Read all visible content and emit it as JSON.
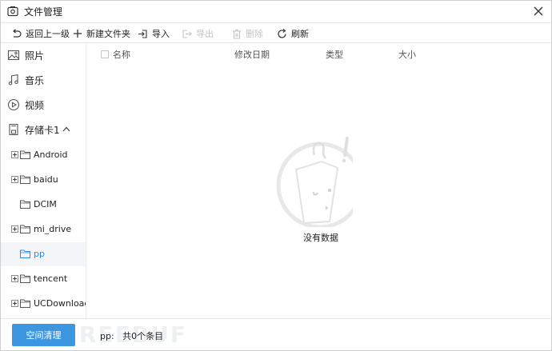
{
  "window": {
    "title": "文件管理",
    "app_icon": "camera-icon",
    "close_icon": "close-icon"
  },
  "toolbar": {
    "back": {
      "label": "返回上一级",
      "icon": "undo-arrow-icon",
      "enabled": true
    },
    "new_folder": {
      "label": "新建文件夹",
      "icon": "plus-icon",
      "enabled": true
    },
    "import": {
      "label": "导入",
      "icon": "import-icon",
      "enabled": true
    },
    "export": {
      "label": "导出",
      "icon": "export-icon",
      "enabled": false
    },
    "delete": {
      "label": "删除",
      "icon": "trash-icon",
      "enabled": false
    },
    "refresh": {
      "label": "刷新",
      "icon": "refresh-icon",
      "enabled": true
    }
  },
  "sidebar": {
    "categories": [
      {
        "label": "照片",
        "icon": "photo-icon"
      },
      {
        "label": "音乐",
        "icon": "music-note-icon"
      },
      {
        "label": "视频",
        "icon": "play-circle-icon"
      }
    ],
    "storage": {
      "label": "存储卡1",
      "icon": "sd-card-icon",
      "toggle_icon": "chevron-up-icon"
    },
    "folders": [
      {
        "label": "Android",
        "expandable": true,
        "selected": false
      },
      {
        "label": "baidu",
        "expandable": true,
        "selected": false
      },
      {
        "label": "DCIM",
        "expandable": false,
        "selected": false
      },
      {
        "label": "mi_drive",
        "expandable": true,
        "selected": false
      },
      {
        "label": "pp",
        "expandable": false,
        "selected": true
      },
      {
        "label": "tencent",
        "expandable": true,
        "selected": false
      },
      {
        "label": "UCDownloads",
        "expandable": true,
        "selected": false
      }
    ]
  },
  "columns": {
    "name": "名称",
    "modified": "修改日期",
    "type": "类型",
    "size": "大小"
  },
  "empty_state": {
    "text": "没有数据",
    "icon": "empty-bag-icon"
  },
  "footer": {
    "clean_button": "空间清理",
    "folder": "pp:",
    "count_text": "共0个条目",
    "watermark": "REEBUF"
  },
  "colors": {
    "accent": "#3d96e0",
    "selected_text": "#2e8ae6",
    "selected_bg": "#f3f5f8",
    "disabled": "#c4c4c4"
  }
}
